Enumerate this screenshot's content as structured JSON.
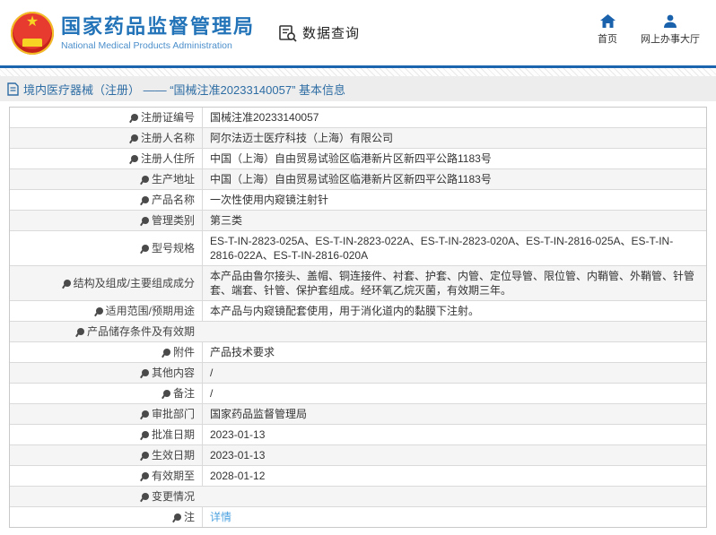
{
  "header": {
    "agency_name_cn": "国家药品监督管理局",
    "agency_name_en": "National Medical Products Administration",
    "nav_search_label": "数据查询",
    "nav_home_label": "首页",
    "nav_hall_label": "网上办事大厅"
  },
  "breadcrumb": {
    "text": "境内医疗器械（注册） —— “国械注准20233140057” 基本信息"
  },
  "colors": {
    "accent_blue": "#1b64ae",
    "title_blue": "#2273b8",
    "breadcrumb_blue": "#2e6da4",
    "link_blue": "#4da3e0",
    "emblem_red": "#d9251c",
    "emblem_gold": "#f7d423",
    "row_alt_bg": "#f5f5f5",
    "border_gray": "#c9c9c9"
  },
  "table": {
    "rows": [
      {
        "label": "注册证编号",
        "value": "国械注准20233140057"
      },
      {
        "label": "注册人名称",
        "value": "阿尔法迈士医疗科技（上海）有限公司"
      },
      {
        "label": "注册人住所",
        "value": "中国（上海）自由贸易试验区临港新片区新四平公路1183号"
      },
      {
        "label": "生产地址",
        "value": "中国（上海）自由贸易试验区临港新片区新四平公路1183号"
      },
      {
        "label": "产品名称",
        "value": "一次性使用内窥镜注射针"
      },
      {
        "label": "管理类别",
        "value": "第三类"
      },
      {
        "label": "型号规格",
        "value": "ES-T-IN-2823-025A、ES-T-IN-2823-022A、ES-T-IN-2823-020A、ES-T-IN-2816-025A、ES-T-IN-2816-022A、ES-T-IN-2816-020A"
      },
      {
        "label": "结构及组成/主要组成成分",
        "value": "本产品由鲁尔接头、盖帽、铜连接件、衬套、护套、内管、定位导管、限位管、内鞘管、外鞘管、针管套、端套、针管、保护套组成。经环氧乙烷灭菌，有效期三年。"
      },
      {
        "label": "适用范围/预期用途",
        "value": "本产品与内窥镜配套使用，用于消化道内的黏膜下注射。"
      },
      {
        "label": "产品储存条件及有效期",
        "value": "",
        "no_divider": true
      },
      {
        "label": "附件",
        "value": "产品技术要求"
      },
      {
        "label": "其他内容",
        "value": "/"
      },
      {
        "label": "备注",
        "value": "/"
      },
      {
        "label": "审批部门",
        "value": "国家药品监督管理局"
      },
      {
        "label": "批准日期",
        "value": "2023-01-13"
      },
      {
        "label": "生效日期",
        "value": "2023-01-13"
      },
      {
        "label": "有效期至",
        "value": "2028-01-12"
      },
      {
        "label": "变更情况",
        "value": "",
        "no_divider": true
      },
      {
        "label": "注",
        "value": "详情",
        "link": true,
        "icon": "note-pin-icon"
      }
    ]
  }
}
